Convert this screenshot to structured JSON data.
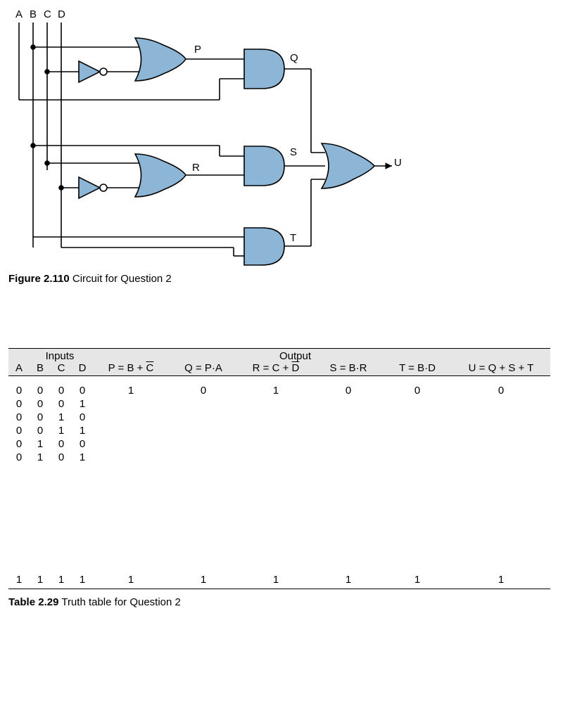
{
  "circuit": {
    "inputs": [
      "A",
      "B",
      "C",
      "D"
    ],
    "signals": {
      "P": "P",
      "Q": "Q",
      "R": "R",
      "S": "S",
      "T": "T",
      "U": "U"
    },
    "figure_caption_bold": "Figure 2.110",
    "figure_caption_rest": " Circuit for Question 2"
  },
  "table": {
    "group_inputs": "Inputs",
    "group_output": "Output",
    "headers": {
      "A": "A",
      "B": "B",
      "C": "C",
      "D": "D",
      "P_pre": "P = B + ",
      "P_over": "C",
      "Q": "Q = P·A",
      "R_pre": "R = C + ",
      "R_over": "D",
      "S": "S = B·R",
      "T": "T = B·D",
      "U": "U = Q + S + T"
    },
    "rows": [
      {
        "A": "0",
        "B": "0",
        "C": "0",
        "D": "0",
        "P": "1",
        "Q": "0",
        "R": "1",
        "S": "0",
        "T": "0",
        "U": "0"
      },
      {
        "A": "0",
        "B": "0",
        "C": "0",
        "D": "1",
        "P": "",
        "Q": "",
        "R": "",
        "S": "",
        "T": "",
        "U": ""
      },
      {
        "A": "0",
        "B": "0",
        "C": "1",
        "D": "0",
        "P": "",
        "Q": "",
        "R": "",
        "S": "",
        "T": "",
        "U": ""
      },
      {
        "A": "0",
        "B": "0",
        "C": "1",
        "D": "1",
        "P": "",
        "Q": "",
        "R": "",
        "S": "",
        "T": "",
        "U": ""
      },
      {
        "A": "0",
        "B": "1",
        "C": "0",
        "D": "0",
        "P": "",
        "Q": "",
        "R": "",
        "S": "",
        "T": "",
        "U": ""
      },
      {
        "A": "0",
        "B": "1",
        "C": "0",
        "D": "1",
        "P": "",
        "Q": "",
        "R": "",
        "S": "",
        "T": "",
        "U": ""
      }
    ],
    "last_row": {
      "A": "1",
      "B": "1",
      "C": "1",
      "D": "1",
      "P": "1",
      "Q": "1",
      "R": "1",
      "S": "1",
      "T": "1",
      "U": "1"
    },
    "table_caption_bold": "Table 2.29",
    "table_caption_rest": " Truth table for Question 2"
  }
}
